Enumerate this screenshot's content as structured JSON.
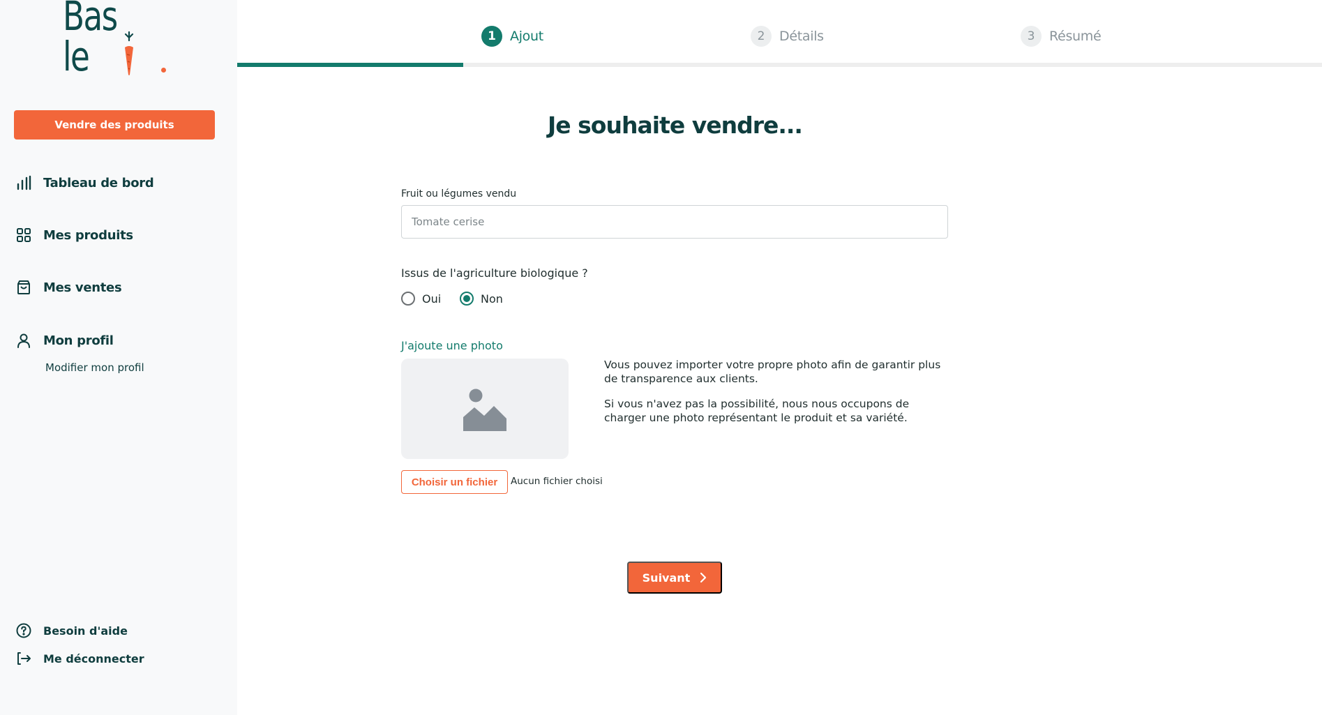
{
  "brand": {
    "logo_text": "Basile",
    "primary_color": "#137b6c",
    "accent_color": "#f2663a",
    "text_color": "#0f3d3e"
  },
  "sidebar": {
    "cta_label": "Vendre des produits",
    "nav": [
      {
        "label": "Tableau de bord",
        "icon": "bar-chart-icon"
      },
      {
        "label": "Mes produits",
        "icon": "grid-icon"
      },
      {
        "label": "Mes ventes",
        "icon": "shopping-bag-icon"
      },
      {
        "label": "Mon profil",
        "icon": "user-icon"
      }
    ],
    "profile_sub_link": "Modifier mon profil",
    "help_label": "Besoin d'aide",
    "logout_label": "Me déconnecter"
  },
  "stepper": {
    "progress": 0.2083,
    "steps": [
      {
        "number": "1",
        "label": "Ajout",
        "state": "active"
      },
      {
        "number": "2",
        "label": "Détails",
        "state": "inactive"
      },
      {
        "number": "3",
        "label": "Résumé",
        "state": "inactive"
      }
    ]
  },
  "form": {
    "heading": "Je souhaite vendre...",
    "product_label": "Fruit ou légumes vendu",
    "product_placeholder": "Tomate cerise",
    "product_value": "",
    "organic_question": "Issus de l'agriculture biologique ?",
    "organic_options": [
      {
        "label": "Oui",
        "checked": false
      },
      {
        "label": "Non",
        "checked": true
      }
    ],
    "photo_label": "J'ajoute une photo",
    "photo_help_1": "Vous pouvez importer votre propre photo afin de garantir plus de transparence aux clients.",
    "photo_help_2": "Si vous n'avez pas la possibilité, nous nous occupons de charger une photo représentant le produit et sa variété.",
    "file_button_label": "Choisir un fichier",
    "file_status": "Aucun fichier choisi",
    "next_label": "Suivant"
  }
}
